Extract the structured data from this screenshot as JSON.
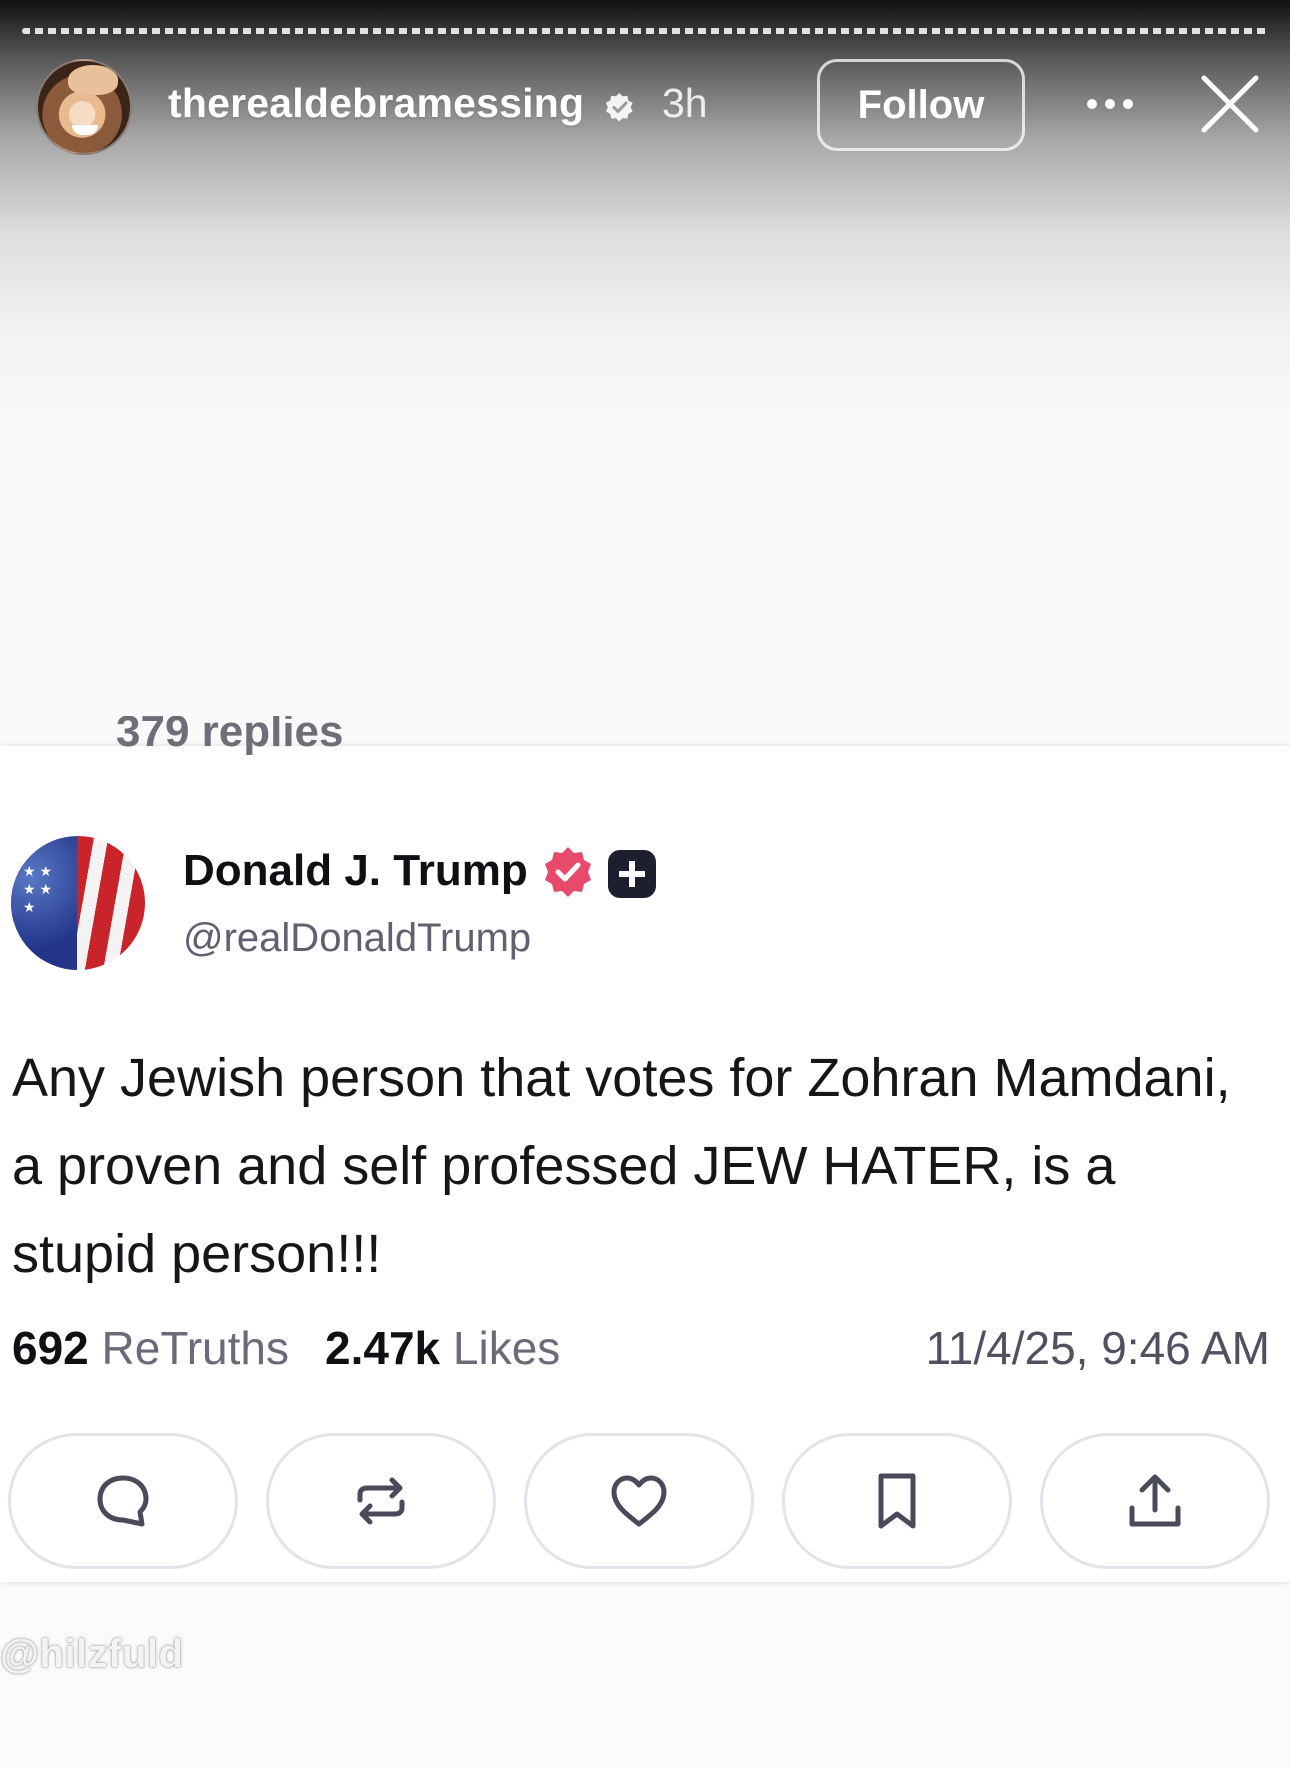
{
  "story": {
    "username": "therealdebramessing",
    "time_ago": "3h",
    "follow_label": "Follow",
    "icons": {
      "verified": "verified-badge-icon",
      "more": "more-horizontal-icon",
      "close": "close-icon"
    }
  },
  "post": {
    "replies_partial": "379 replies",
    "display_name": "Donald J. Trump",
    "handle": "@realDonaldTrump",
    "text": "Any Jewish person that votes for Zohran Mamdani, a proven and self professed JEW HATER, is a stupid person!!!",
    "retruths_count": "692",
    "retruths_label": "ReTruths",
    "likes_count": "2.47k",
    "likes_label": "Likes",
    "timestamp": "11/4/25, 9:46 AM",
    "badge_color": "#e84a6c",
    "actions": [
      "reply-icon",
      "retruth-icon",
      "like-icon",
      "bookmark-icon",
      "share-icon"
    ]
  },
  "watermark": "@hilzfuld"
}
